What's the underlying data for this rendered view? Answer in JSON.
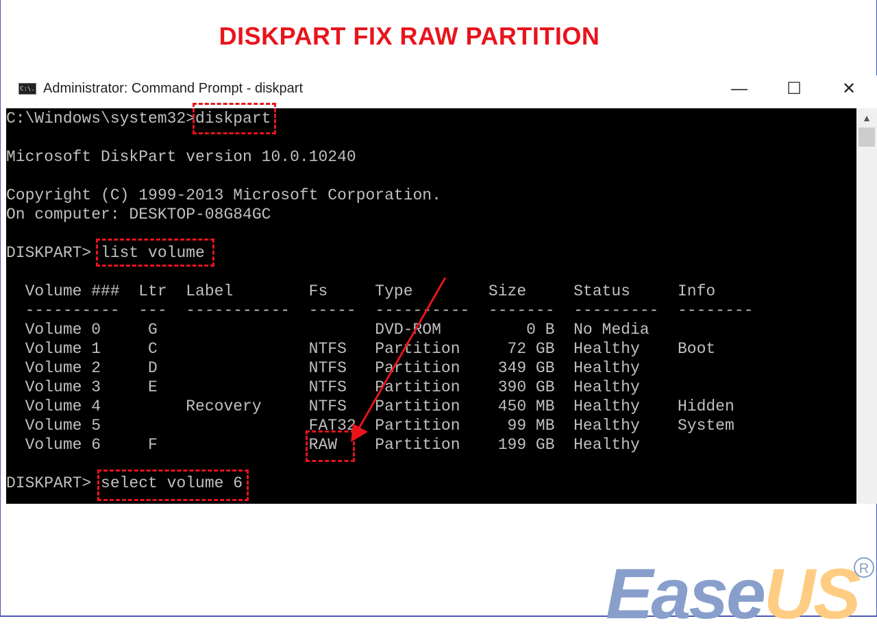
{
  "heading": "DISKPART FIX RAW PARTITION",
  "window": {
    "title": "Administrator: Command Prompt - diskpart",
    "icon": "cmd-icon",
    "icon_text": "C:\\.",
    "minimize": "—",
    "maximize": "☐",
    "close": "✕"
  },
  "terminal": {
    "lines": [
      "C:\\Windows\\system32>diskpart",
      "",
      "Microsoft DiskPart version 10.0.10240",
      "",
      "Copyright (C) 1999-2013 Microsoft Corporation.",
      "On computer: DESKTOP-08G84GC",
      "",
      "DISKPART> list volume",
      "",
      "  Volume ###  Ltr  Label        Fs     Type        Size     Status     Info",
      "  ----------  ---  -----------  -----  ----------  -------  ---------  --------",
      "  Volume 0     G                       DVD-ROM         0 B  No Media",
      "  Volume 1     C                NTFS   Partition     72 GB  Healthy    Boot",
      "  Volume 2     D                NTFS   Partition    349 GB  Healthy",
      "  Volume 3     E                NTFS   Partition    390 GB  Healthy",
      "  Volume 4         Recovery     NTFS   Partition    450 MB  Healthy    Hidden",
      "  Volume 5                      FAT32  Partition     99 MB  Healthy    System",
      "  Volume 6     F                RAW    Partition    199 GB  Healthy",
      "",
      "DISKPART> select volume 6"
    ]
  },
  "scrollbar": {
    "up": "▲"
  },
  "logo": {
    "ease": "Ease",
    "us": "US",
    "reg": "R"
  },
  "colors": {
    "highlight": "#e8141c",
    "logo_blue": "#889fcc",
    "logo_orange": "#fecc82"
  }
}
